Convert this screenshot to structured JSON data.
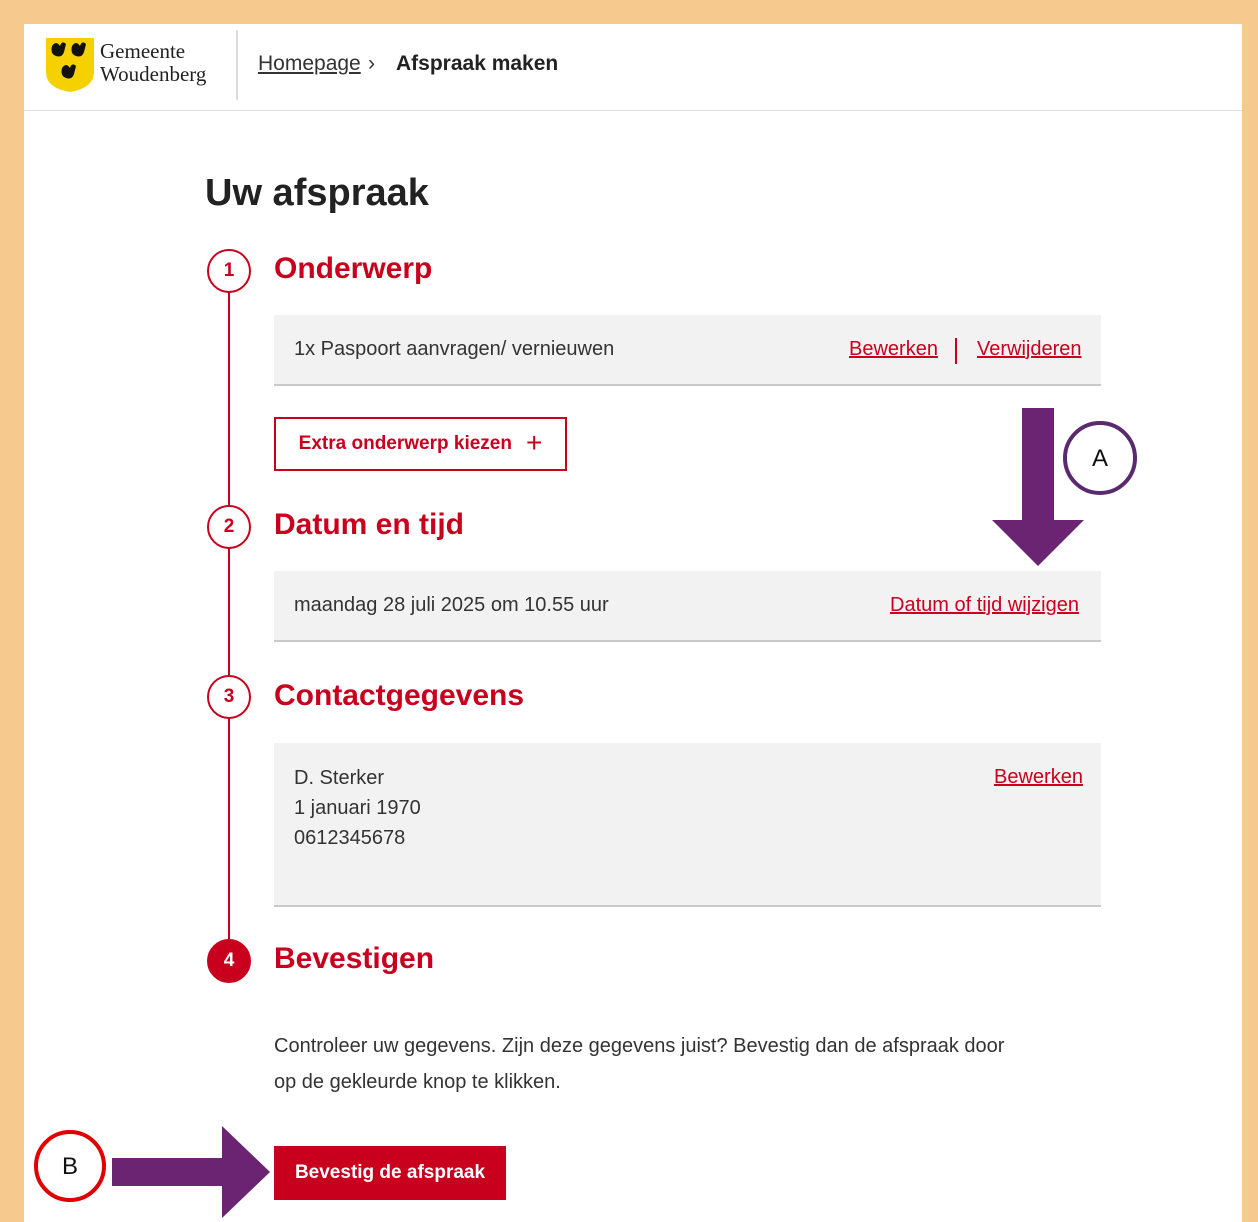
{
  "header": {
    "logo_line1": "Gemeente",
    "logo_line2": "Woudenberg",
    "breadcrumb_home": "Homepage",
    "breadcrumb_sep": "›",
    "breadcrumb_current": "Afspraak maken"
  },
  "title": "Uw afspraak",
  "steps": [
    {
      "number": "1",
      "title": "Onderwerp"
    },
    {
      "number": "2",
      "title": "Datum en tijd"
    },
    {
      "number": "3",
      "title": "Contactgegevens"
    },
    {
      "number": "4",
      "title": "Bevestigen"
    }
  ],
  "subject": {
    "text": "1x Paspoort aanvragen/ vernieuwen",
    "edit_label": "Bewerken",
    "delete_label": "Verwijderen",
    "extra_button": "Extra onderwerp kiezen",
    "extra_icon": "plus-icon"
  },
  "datetime": {
    "text": "maandag 28 juli 2025 om 10.55 uur",
    "change_label": "Datum of tijd wijzigen"
  },
  "contact": {
    "name": "D. Sterker",
    "birthdate": "1 januari 1970",
    "phone": "0612345678",
    "edit_label": "Bewerken"
  },
  "confirm": {
    "text": "Controleer uw gegevens. Zijn deze gegevens juist? Bevestig dan de afspraak door op de gekleurde knop te klikken.",
    "button_label": "Bevestig de afspraak"
  },
  "annotations": {
    "marker_a": "A",
    "marker_b": "B",
    "arrow_color": "#6a2472",
    "marker_a_color": "#5a2a6e",
    "marker_b_color": "#e00000"
  },
  "colors": {
    "accent": "#c8001e",
    "frame": "#f6c98f",
    "card_bg": "#f2f2f2"
  }
}
